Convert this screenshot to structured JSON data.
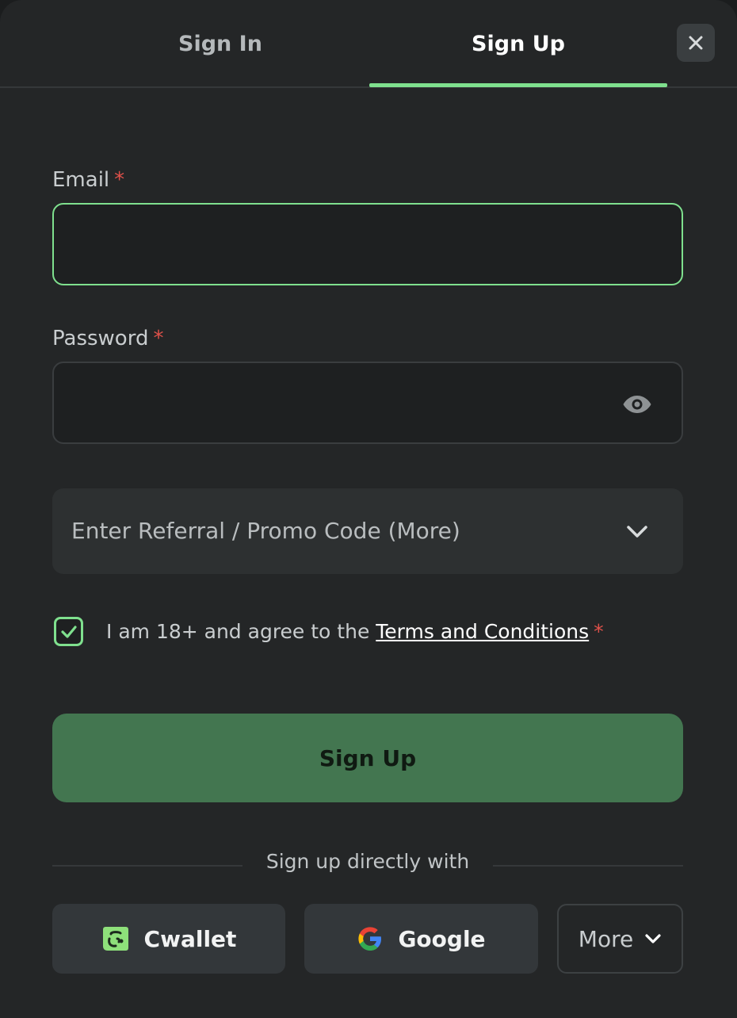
{
  "tabs": {
    "sign_in": "Sign In",
    "sign_up": "Sign Up",
    "active": "Sign Up",
    "close_icon": "close-icon"
  },
  "form": {
    "email_label": "Email",
    "email_value": "",
    "password_label": "Password",
    "password_value": "",
    "required_mark": "*",
    "eye_icon": "eye-icon",
    "promo_label": "Enter Referral / Promo Code (More)",
    "agree_prefix": "I am 18+ and agree to the ",
    "agree_link": "Terms and Conditions",
    "agree_checked": true,
    "submit_label": "Sign Up"
  },
  "social": {
    "divider_text": "Sign up directly with",
    "cwallet_label": "Cwallet",
    "google_label": "Google",
    "more_label": "More"
  },
  "colors": {
    "accent": "#7fe08e",
    "primary_button": "#437650",
    "required": "#e0514a",
    "background": "#242627"
  }
}
